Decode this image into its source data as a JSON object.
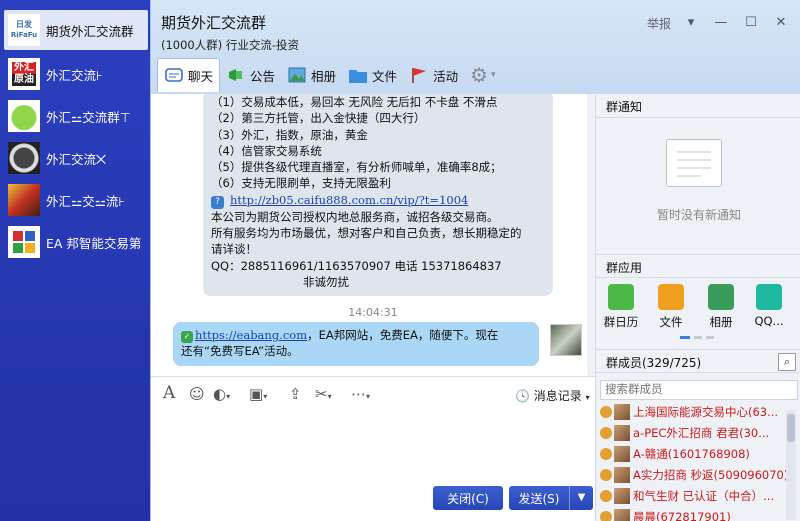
{
  "sidebar": {
    "items": [
      {
        "label": "期货外汇交流群",
        "avatar": "日发 RiFaFu"
      },
      {
        "label": "外汇交流⊦",
        "avatar": "外汇 原油"
      },
      {
        "label": "外汇⚍交流群⊤",
        "avatar": ""
      },
      {
        "label": "外汇交流⨉",
        "avatar": ""
      },
      {
        "label": "外汇⚍交⚍流⊦",
        "avatar": ""
      },
      {
        "label": "EA 邦智能交易第",
        "avatar": ""
      }
    ]
  },
  "window": {
    "title": "期货外汇交流群",
    "subtitle": "(1000人群) 行业交流-投资",
    "report": "举报"
  },
  "tabs": [
    {
      "label": "聊天"
    },
    {
      "label": "公告"
    },
    {
      "label": "相册"
    },
    {
      "label": "文件"
    },
    {
      "label": "活动"
    }
  ],
  "chat": {
    "msg1_lines": [
      "（1）交易成本低，易回本 无风险  无后扣  不卡盘 不滑点",
      "（2）第三方托管，出入金快捷（四大行）",
      "（3）外汇，指数，原油，黄金",
      "（4）信管家交易系统",
      "（5）提供各级代理直播室，有分析师喊单，准确率8成；",
      "（6）支持无限刷单，支持无限盈利"
    ],
    "msg1_link": "http://zb05.caifu888.com.cn/vip/?t=1004",
    "msg1_after": [
      "本公司为期货公司授权内地总服务商，诚招各级交易商。",
      "所有服务均为市场最优，想对客户和自己负责，想长期稳定的",
      "请详谈！",
      "QQ：2885116961/1163570907 电话 15371864837",
      "非诚勿扰"
    ],
    "timestamp": "14:04:31",
    "msg2_link": "https://eabang.com",
    "msg2_text1": "，EA邦网站，免费EA，随便下。现在",
    "msg2_text2": "还有“免费写EA”活动。"
  },
  "toolbar": {
    "history": "消息记录"
  },
  "buttons": {
    "close": "关闭(C)",
    "send": "发送(S)"
  },
  "right": {
    "notice_header": "群通知",
    "notice_empty": "暂时没有新通知",
    "apps_header": "群应用",
    "apps": [
      {
        "label": "群日历"
      },
      {
        "label": "文件"
      },
      {
        "label": "相册"
      },
      {
        "label": "QQ..."
      }
    ],
    "members_header": "群成员(329/725)",
    "member_search_placeholder": "搜索群成员",
    "members": [
      {
        "name": "上海国际能源交易中心(63..."
      },
      {
        "name": "a-PEC外汇招商  君君(30..."
      },
      {
        "name": "A-赣通(1601768908)"
      },
      {
        "name": "A实力招商 秒返(509096070)"
      },
      {
        "name": "和气生财 已认证（中合）..."
      },
      {
        "name": "晨晨(672817901)"
      }
    ]
  },
  "colors": {
    "sidebar": "#2b3fbf",
    "accent_button": "#2f50c0",
    "bubble_self": "#aad7f5",
    "bubble_other": "#dfe5ec",
    "member_name": "#d01818"
  }
}
